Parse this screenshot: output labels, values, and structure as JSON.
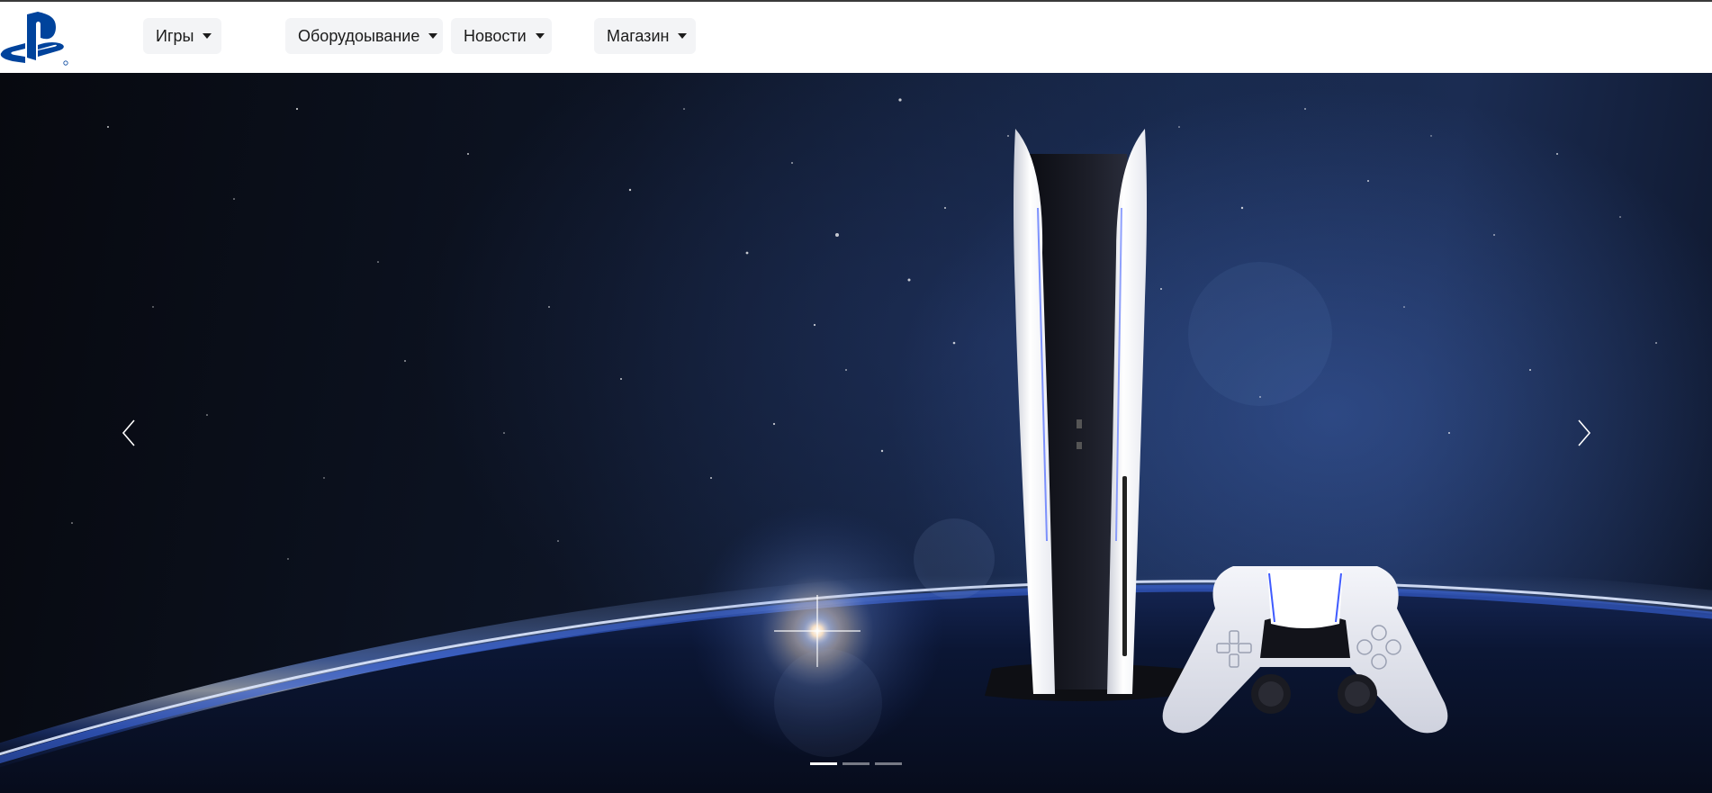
{
  "brand": {
    "logo_icon": "playstation-logo-icon",
    "color": "#00439c"
  },
  "nav": {
    "items": [
      {
        "label": "Игры",
        "icon": "caret-down-icon"
      },
      {
        "label": "Оборудоывание",
        "icon": "caret-down-icon"
      },
      {
        "label": "Новости",
        "icon": "caret-down-icon"
      },
      {
        "label": "Магазин",
        "icon": "caret-down-icon"
      }
    ]
  },
  "hero": {
    "slide_image": "ps5-console-and-dualsense-controller-over-earth-horizon",
    "prev_icon": "chevron-left-icon",
    "next_icon": "chevron-right-icon",
    "slide_count": 3,
    "active_slide": 1
  }
}
